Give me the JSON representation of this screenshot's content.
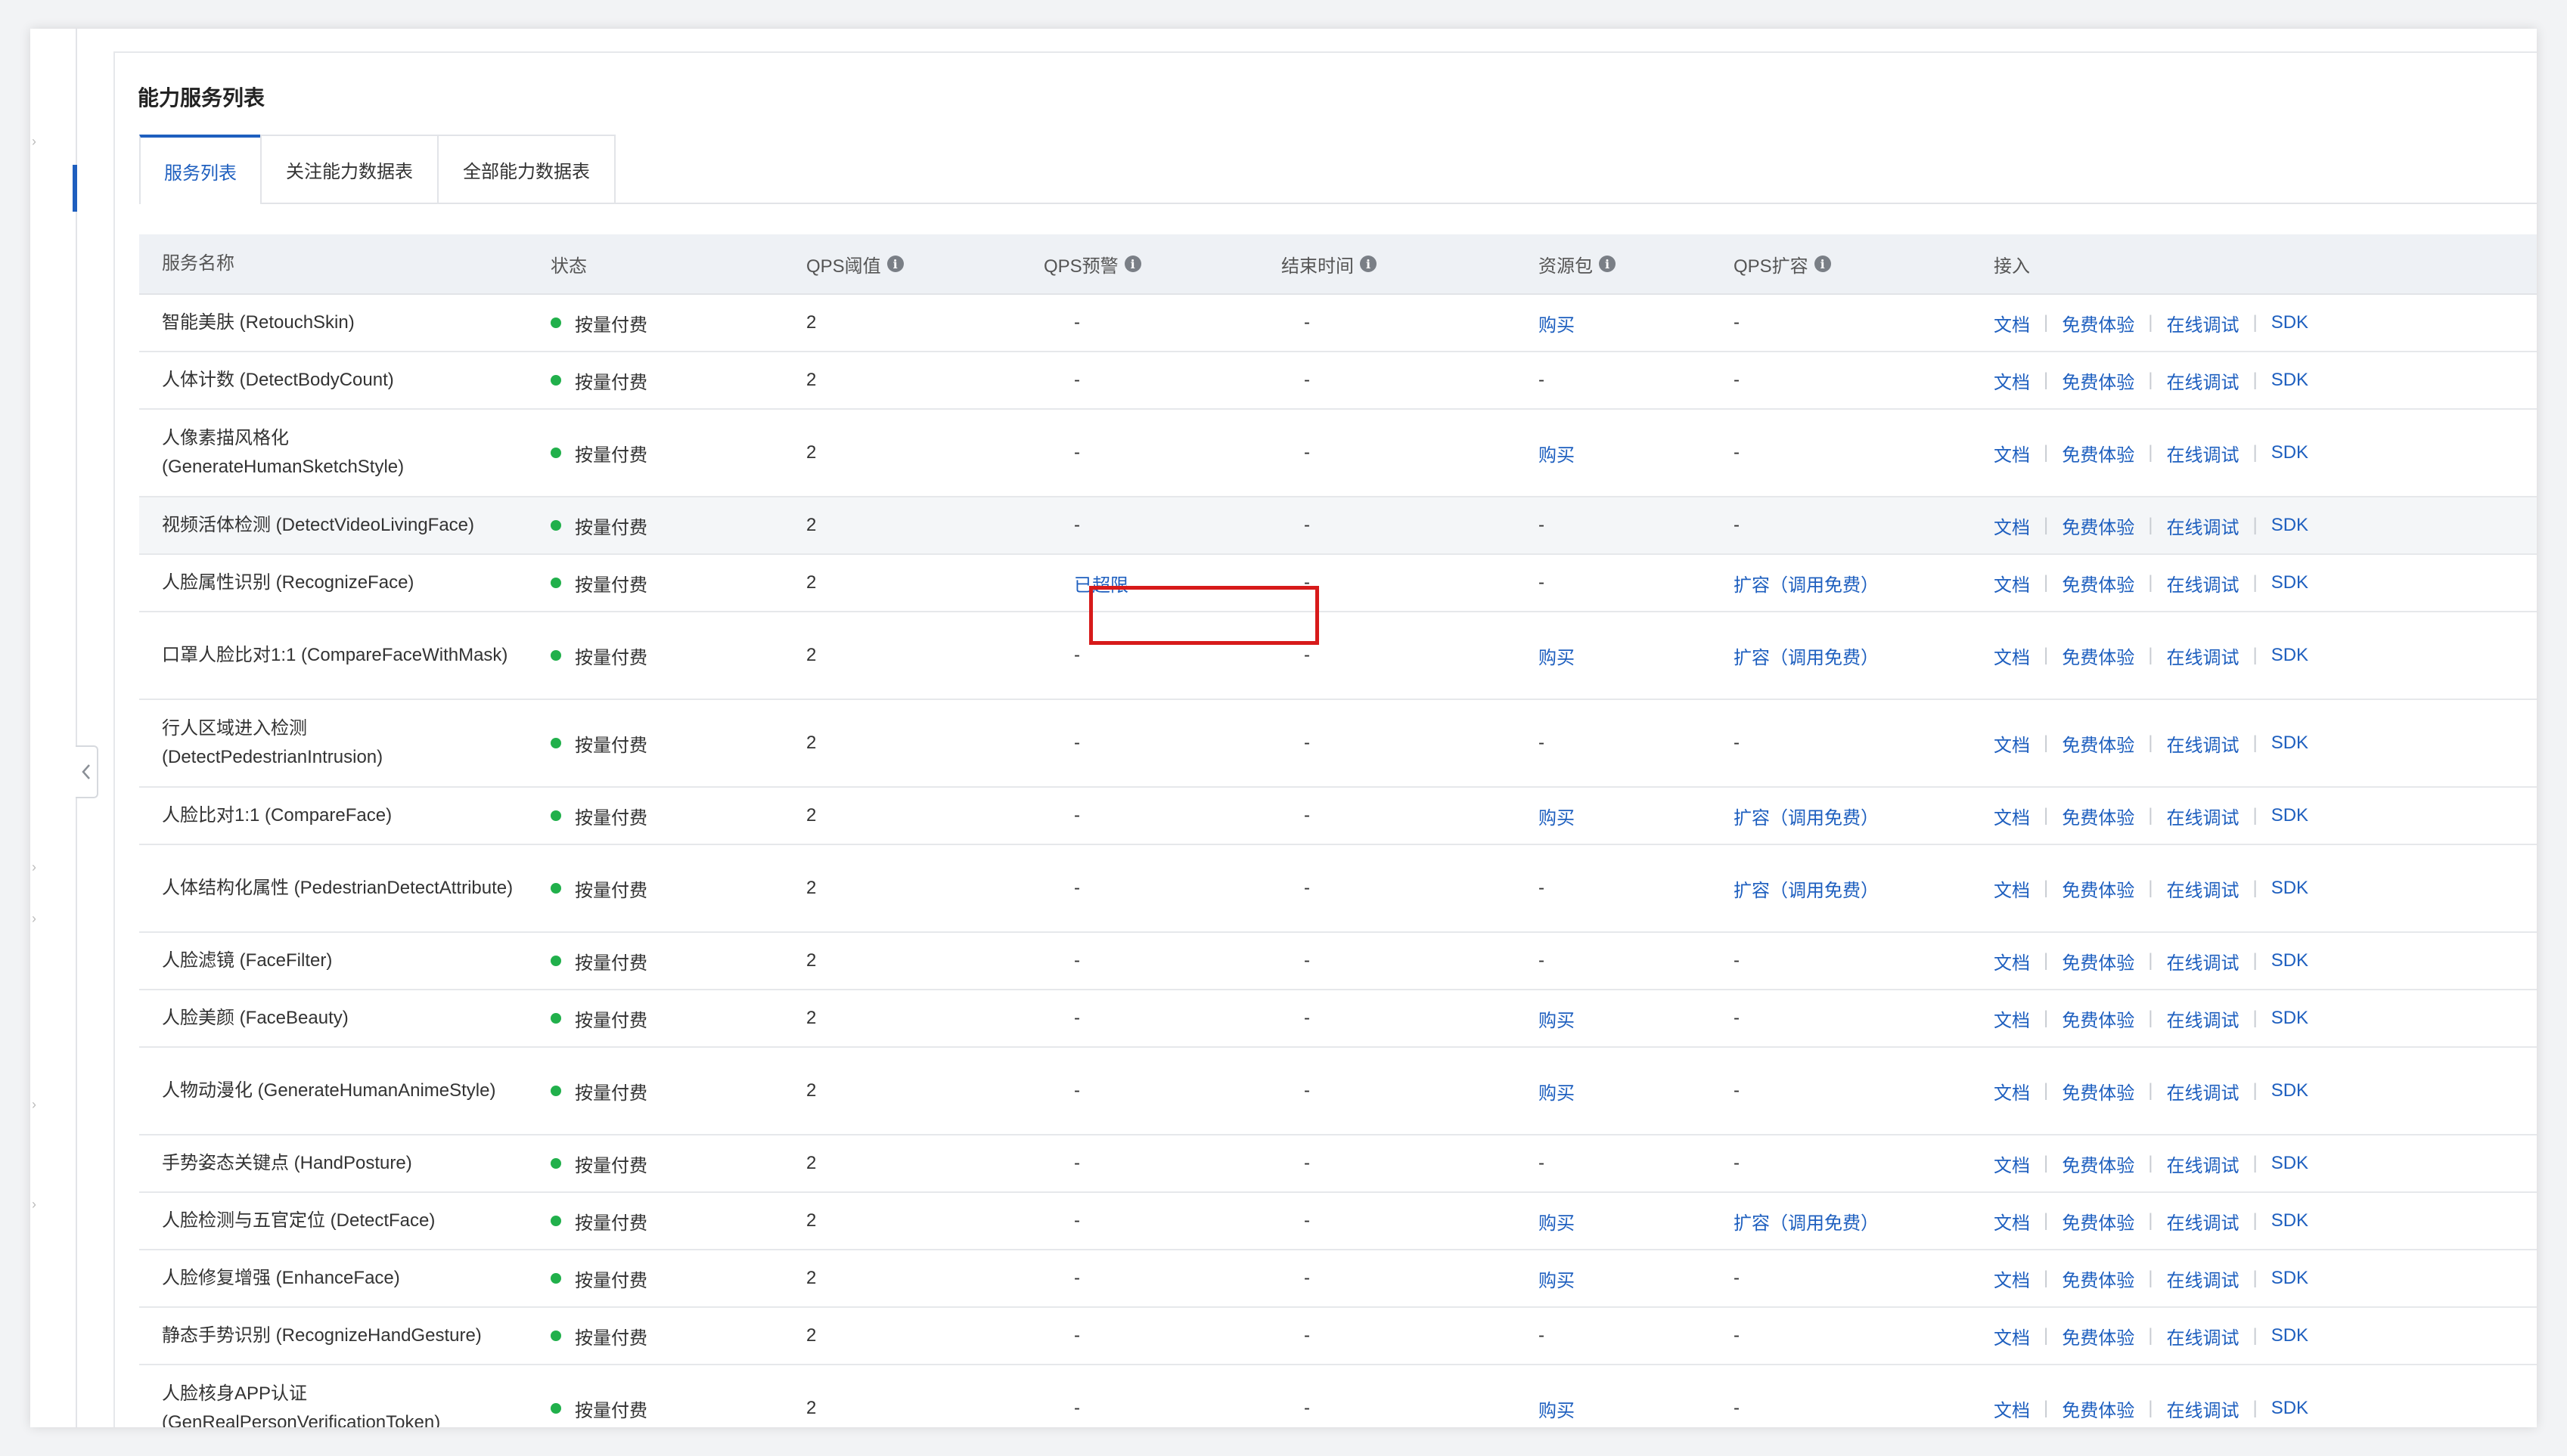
{
  "page": {
    "title": "能力服务列表"
  },
  "tabs": [
    {
      "label": "服务列表",
      "active": true
    },
    {
      "label": "关注能力数据表",
      "active": false
    },
    {
      "label": "全部能力数据表",
      "active": false
    }
  ],
  "table": {
    "headers": {
      "name": "服务名称",
      "status": "状态",
      "qps_threshold": "QPS阈值",
      "qps_warning": "QPS预警",
      "end_time": "结束时间",
      "resource_pack": "资源包",
      "qps_expand": "QPS扩容",
      "access": "接入"
    },
    "info_glyph": "i",
    "access_links": {
      "docs": "文档",
      "trial": "免费体验",
      "debug": "在线调试",
      "sdk": "SDK",
      "separator": "|"
    },
    "rows": [
      {
        "name": "智能美肤 (RetouchSkin)",
        "status": "按量付费",
        "qps_threshold": "2",
        "qps_warning": "-",
        "end_time": "-",
        "resource_pack": "购买",
        "qps_expand": "-"
      },
      {
        "name": "人体计数 (DetectBodyCount)",
        "status": "按量付费",
        "qps_threshold": "2",
        "qps_warning": "-",
        "end_time": "-",
        "resource_pack": "-",
        "qps_expand": "-"
      },
      {
        "name": "人像素描风格化 (GenerateHumanSketchStyle)",
        "status": "按量付费",
        "qps_threshold": "2",
        "qps_warning": "-",
        "end_time": "-",
        "resource_pack": "购买",
        "qps_expand": "-"
      },
      {
        "name": "视频活体检测 (DetectVideoLivingFace)",
        "status": "按量付费",
        "qps_threshold": "2",
        "qps_warning": "-",
        "end_time": "-",
        "resource_pack": "-",
        "qps_expand": "-"
      },
      {
        "name": "人脸属性识别 (RecognizeFace)",
        "status": "按量付费",
        "qps_threshold": "2",
        "qps_warning": "已超限",
        "end_time": "-",
        "resource_pack": "-",
        "qps_expand": "扩容（调用免费）"
      },
      {
        "name": "口罩人脸比对1:1 (CompareFaceWithMask)",
        "status": "按量付费",
        "qps_threshold": "2",
        "qps_warning": "-",
        "end_time": "-",
        "resource_pack": "购买",
        "qps_expand": "扩容（调用免费）"
      },
      {
        "name": "行人区域进入检测 (DetectPedestrianIntrusion)",
        "status": "按量付费",
        "qps_threshold": "2",
        "qps_warning": "-",
        "end_time": "-",
        "resource_pack": "-",
        "qps_expand": "-"
      },
      {
        "name": "人脸比对1:1 (CompareFace)",
        "status": "按量付费",
        "qps_threshold": "2",
        "qps_warning": "-",
        "end_time": "-",
        "resource_pack": "购买",
        "qps_expand": "扩容（调用免费）"
      },
      {
        "name": "人体结构化属性 (PedestrianDetectAttribute)",
        "status": "按量付费",
        "qps_threshold": "2",
        "qps_warning": "-",
        "end_time": "-",
        "resource_pack": "-",
        "qps_expand": "扩容（调用免费）"
      },
      {
        "name": "人脸滤镜 (FaceFilter)",
        "status": "按量付费",
        "qps_threshold": "2",
        "qps_warning": "-",
        "end_time": "-",
        "resource_pack": "-",
        "qps_expand": "-"
      },
      {
        "name": "人脸美颜 (FaceBeauty)",
        "status": "按量付费",
        "qps_threshold": "2",
        "qps_warning": "-",
        "end_time": "-",
        "resource_pack": "购买",
        "qps_expand": "-"
      },
      {
        "name": "人物动漫化 (GenerateHumanAnimeStyle)",
        "status": "按量付费",
        "qps_threshold": "2",
        "qps_warning": "-",
        "end_time": "-",
        "resource_pack": "购买",
        "qps_expand": "-"
      },
      {
        "name": "手势姿态关键点 (HandPosture)",
        "status": "按量付费",
        "qps_threshold": "2",
        "qps_warning": "-",
        "end_time": "-",
        "resource_pack": "-",
        "qps_expand": "-"
      },
      {
        "name": "人脸检测与五官定位 (DetectFace)",
        "status": "按量付费",
        "qps_threshold": "2",
        "qps_warning": "-",
        "end_time": "-",
        "resource_pack": "购买",
        "qps_expand": "扩容（调用免费）"
      },
      {
        "name": "人脸修复增强 (EnhanceFace)",
        "status": "按量付费",
        "qps_threshold": "2",
        "qps_warning": "-",
        "end_time": "-",
        "resource_pack": "购买",
        "qps_expand": "-"
      },
      {
        "name": "静态手势识别 (RecognizeHandGesture)",
        "status": "按量付费",
        "qps_threshold": "2",
        "qps_warning": "-",
        "end_time": "-",
        "resource_pack": "-",
        "qps_expand": "-"
      },
      {
        "name": "人脸核身APP认证 (GenRealPersonVerificationToken)",
        "status": "按量付费",
        "qps_threshold": "2",
        "qps_warning": "-",
        "end_time": "-",
        "resource_pack": "购买",
        "qps_expand": "-"
      }
    ]
  },
  "colors": {
    "accent": "#1e5fbf",
    "status_dot": "#21b04b",
    "highlight": "#d71a1a",
    "header_bg": "#eef1f5"
  },
  "icons": {
    "collapse": "chevron-left-icon",
    "info": "info-icon",
    "status": "status-dot-icon"
  }
}
